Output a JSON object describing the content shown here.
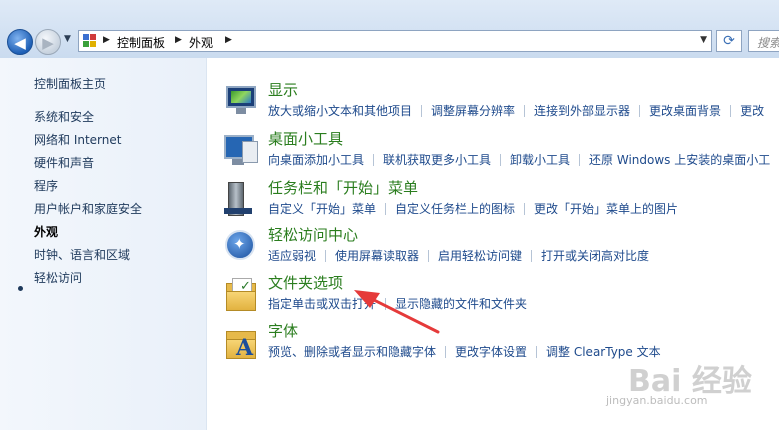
{
  "address_bar": {
    "crumbs": [
      "控制面板",
      "外观"
    ],
    "search_placeholder": "搜索控"
  },
  "sidebar": {
    "home": "控制面板主页",
    "items": [
      {
        "label": "系统和安全",
        "current": false
      },
      {
        "label": "网络和 Internet",
        "current": false
      },
      {
        "label": "硬件和声音",
        "current": false
      },
      {
        "label": "程序",
        "current": false
      },
      {
        "label": "用户帐户和家庭安全",
        "current": false
      },
      {
        "label": "外观",
        "current": true
      },
      {
        "label": "时钟、语言和区域",
        "current": false
      },
      {
        "label": "轻松访问",
        "current": false
      }
    ]
  },
  "categories": [
    {
      "icon": "display-icon",
      "title": "显示",
      "links": [
        "放大或缩小文本和其他项目",
        "调整屏幕分辨率",
        "连接到外部显示器",
        "更改桌面背景",
        "更改"
      ]
    },
    {
      "icon": "desktop-gadgets-icon",
      "title": "桌面小工具",
      "links": [
        "向桌面添加小工具",
        "联机获取更多小工具",
        "卸载小工具",
        "还原 Windows 上安装的桌面小工"
      ]
    },
    {
      "icon": "taskbar-start-menu-icon",
      "title": "任务栏和「开始」菜单",
      "links": [
        "自定义「开始」菜单",
        "自定义任务栏上的图标",
        "更改「开始」菜单上的图片"
      ]
    },
    {
      "icon": "ease-of-access-icon",
      "title": "轻松访问中心",
      "links": [
        "适应弱视",
        "使用屏幕读取器",
        "启用轻松访问键",
        "打开或关闭高对比度"
      ]
    },
    {
      "icon": "folder-options-icon",
      "title": "文件夹选项",
      "links": [
        "指定单击或双击打开",
        "显示隐藏的文件和文件夹"
      ]
    },
    {
      "icon": "fonts-icon",
      "title": "字体",
      "links": [
        "预览、删除或者显示和隐藏字体",
        "更改字体设置",
        "调整 ClearType 文本"
      ]
    }
  ],
  "watermark": {
    "brand": "Bai 经验",
    "url": "jingyan.baidu.com"
  },
  "colors": {
    "link": "#1e4a8c",
    "category_title": "#2a7d1e",
    "annotation_arrow": "#e53a3a"
  }
}
